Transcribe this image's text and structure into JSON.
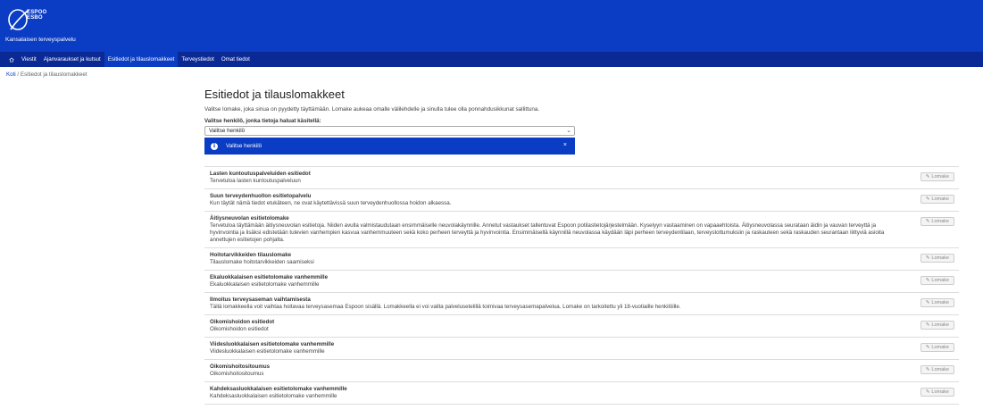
{
  "header": {
    "logo_line1": "ESPOO",
    "logo_line2": "ESBO",
    "site_name": "Kansalaisen terveyspalvelu",
    "brand_color": "#0a3cc4"
  },
  "nav": {
    "home_icon": "home-icon",
    "items": [
      {
        "label": "Viestit"
      },
      {
        "label": "Ajanvaraukset ja kutsut"
      },
      {
        "label": "Esitiedot ja tilauslomakkeet",
        "active": true
      },
      {
        "label": "Terveystiedot"
      },
      {
        "label": "Omat tiedot"
      }
    ]
  },
  "breadcrumb": {
    "home": "Koti",
    "separator": "/",
    "current": "Esitiedot ja tilauslomakkeet"
  },
  "main": {
    "title": "Esitiedot ja tilauslomakkeet",
    "intro": "Valitse lomake, joka sinua on pyydetty täyttämään. Lomake aukeaa omalle välilehdelle ja sinulla tulee olla ponnahdusikkunat sallittuna.",
    "select_label": "Valitse henkilö, jonka tietoja haluat käsitellä:",
    "select_value": "Valitse henkilö",
    "alert_icon": "info-icon",
    "alert_text": "Valitse henkilö",
    "alert_close": "×"
  },
  "form_button_label": "Lomake",
  "forms": [
    {
      "title": "Lasten kuntoutuspalveluiden esitiedot",
      "desc": "Tervetuloa lasten kuntoutuspalveluun"
    },
    {
      "title": "Suun terveydenhuollon esitietopalvelu",
      "desc": "Kun täytät nämä tiedot etukäteen, ne ovat käytettävissä suun terveydenhuollossa hoidon alkaessa."
    },
    {
      "title": "Äitiysneuvolan esitietolomake",
      "desc": "Tervetuloa täyttämään äitiysneuvolan esitietoja. Niiden avulla valmistaudutaan ensimmäiselle neuvolakäynnille. Annetut vastaukset tallentuvat Espoon potilastietojärjestelmään. Kyselyyn vastaaminen on vapaaehtoista. Äitiysneuvolassa seurataan äidin ja vauvan terveyttä ja hyvinvointia ja lisäksi edistetään tulevien vanhempien kasvua vanhemmuuteen sekä koko perheen terveyttä ja hyvinvointia. Ensimmäisellä käynnillä neuvolassa käydään läpi perheen terveydentilaan, terveystottumuksiin ja raskauteen sekä raskauden seurantaan liittyviä asioita annettujen esitietojen pohjalta."
    },
    {
      "title": "Hoitotarvikkeiden tilauslomake",
      "desc": "Tilauslomake hoitotarvikkeiden saamiseksi"
    },
    {
      "title": "Ekaluokkalaisen esitietolomake vanhemmille",
      "desc": "Ekaluokkalaisen esitietolomake vanhemmille"
    },
    {
      "title": "Ilmoitus terveysaseman vaihtamisesta",
      "desc": "Tällä lomakkeella voit vaihtaa hoitavaa terveysasemaa Espoon sisällä. Lomakkeella ei voi valita palvelusetelillä toimivaa terveysasemapalvelua. Lomake on tarkoitettu yli 18-vuotiaille henkilöille."
    },
    {
      "title": "Oikomishoidon esitiedot",
      "desc": "Oikomishoidon esitiedot"
    },
    {
      "title": "Viidesluokkalaisen esitietolomake vanhemmille",
      "desc": "Viidesluokkalaisen esitietolomake vanhemmille"
    },
    {
      "title": "Oikomishoitositoumus",
      "desc": "Oikomishoitositoumus"
    },
    {
      "title": "Kahdeksasluokkalaisen esitietolomake vanhemmille",
      "desc": "Kahdeksasluokkalaisen esitietolomake vanhemmille"
    }
  ]
}
